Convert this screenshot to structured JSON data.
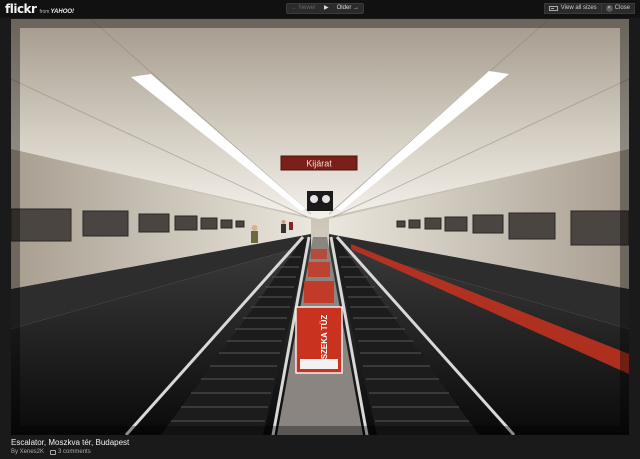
{
  "brand": {
    "logo_text": "flickr",
    "from_text": "from",
    "yahoo_text": "YAHOO!"
  },
  "pager": {
    "newer_label": "← Newer",
    "play_icon": "play-icon",
    "older_label": "Older →"
  },
  "actions": {
    "view_sizes_label": "View all sizes",
    "close_label": "Close"
  },
  "photo": {
    "sign_text": "Kijárat",
    "ad_text": "SZEKA TÜZ"
  },
  "caption": {
    "title": "Escalator, Moszkva tér, Budapest",
    "author": "By Xenes2K",
    "comments": "3 comments"
  },
  "colors": {
    "background": "#1a1a1a",
    "topbar": "#111111",
    "tunnel_ceiling": "#cfc8bb",
    "ad_red": "#c8321e"
  }
}
